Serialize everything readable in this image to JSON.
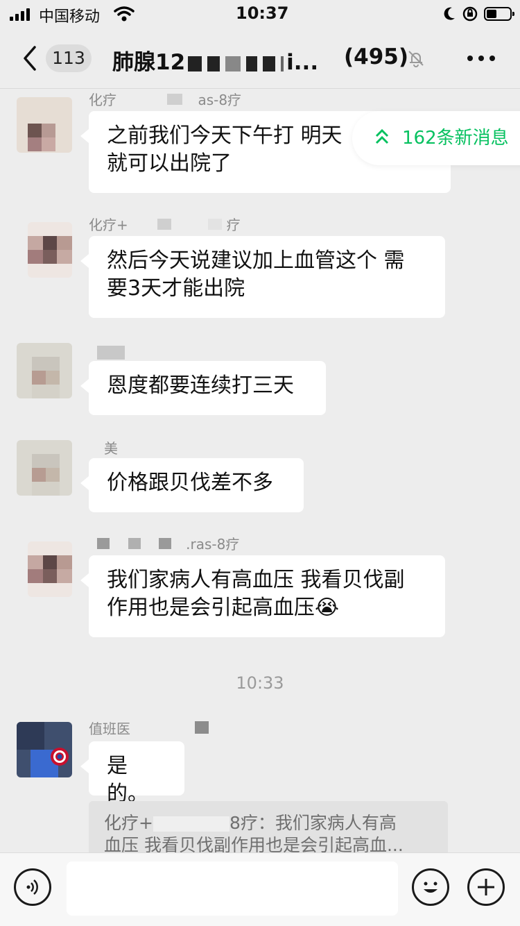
{
  "status_bar": {
    "carrier": "中国移动",
    "time": "10:37"
  },
  "nav": {
    "back_count": "113",
    "title": "肺腺12",
    "title_suffix": "i...",
    "member_count": "(495)"
  },
  "new_messages": {
    "label": "162条新消息"
  },
  "messages": [
    {
      "sender": "化疗",
      "sender_tail": "as-8疗",
      "text_line1": "之前我们今天下午打 明天",
      "text_line2": "就可以出院了"
    },
    {
      "sender": "化疗+",
      "sender_tail": "疗",
      "text_line1": "然后今天说建议加上血管这个 需",
      "text_line2": "要3天才能出院"
    },
    {
      "text_line1": "恩度都要连续打三天"
    },
    {
      "sender": "美",
      "text_line1": "价格跟贝伐差不多"
    },
    {
      "sender_tail": ".ras-8疗",
      "text_line1": "我们家病人有高血压 我看贝伐副",
      "text_line2": "作用也是会引起高血压😭"
    },
    {
      "sender": "值班医",
      "text_line1": "是的。"
    }
  ],
  "timestamp": "10:33",
  "quote": {
    "line1_a": "化疗+",
    "line1_b": "8疗：我们家病人有高",
    "line2": "血压 我看贝伐副作用也是会引起高血..."
  },
  "icons": {
    "back": "chevron-left-icon",
    "mute": "bell-off-icon",
    "more": "more-dots-icon",
    "voice": "voice-icon",
    "emoji": "emoji-icon",
    "plus": "plus-icon"
  },
  "colors": {
    "accent": "#07c160",
    "background": "#ededed"
  }
}
